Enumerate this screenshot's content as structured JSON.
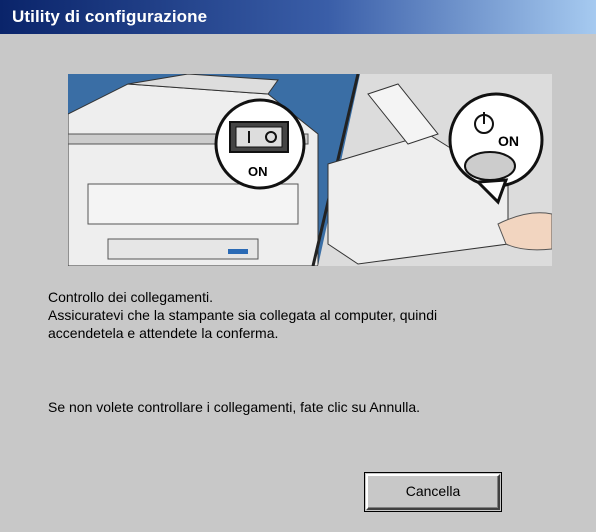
{
  "window": {
    "title": "Utility di configurazione"
  },
  "illustration": {
    "printer_switch_label": "ON",
    "power_button_label": "ON"
  },
  "message": {
    "line1": "Controllo dei collegamenti.",
    "line2": "Assicuratevi che la stampante sia collegata al computer, quindi",
    "line3": "accendetela e attendete la conferma.",
    "line4": "Se non volete controllare i collegamenti, fate clic su Annulla."
  },
  "buttons": {
    "cancel_label": "Cancella"
  },
  "colors": {
    "titlebar_start": "#0a246a",
    "titlebar_end": "#a6caf0",
    "dialog_bg": "#c8c8c8",
    "illustration_sky": "#3a6ea5"
  }
}
